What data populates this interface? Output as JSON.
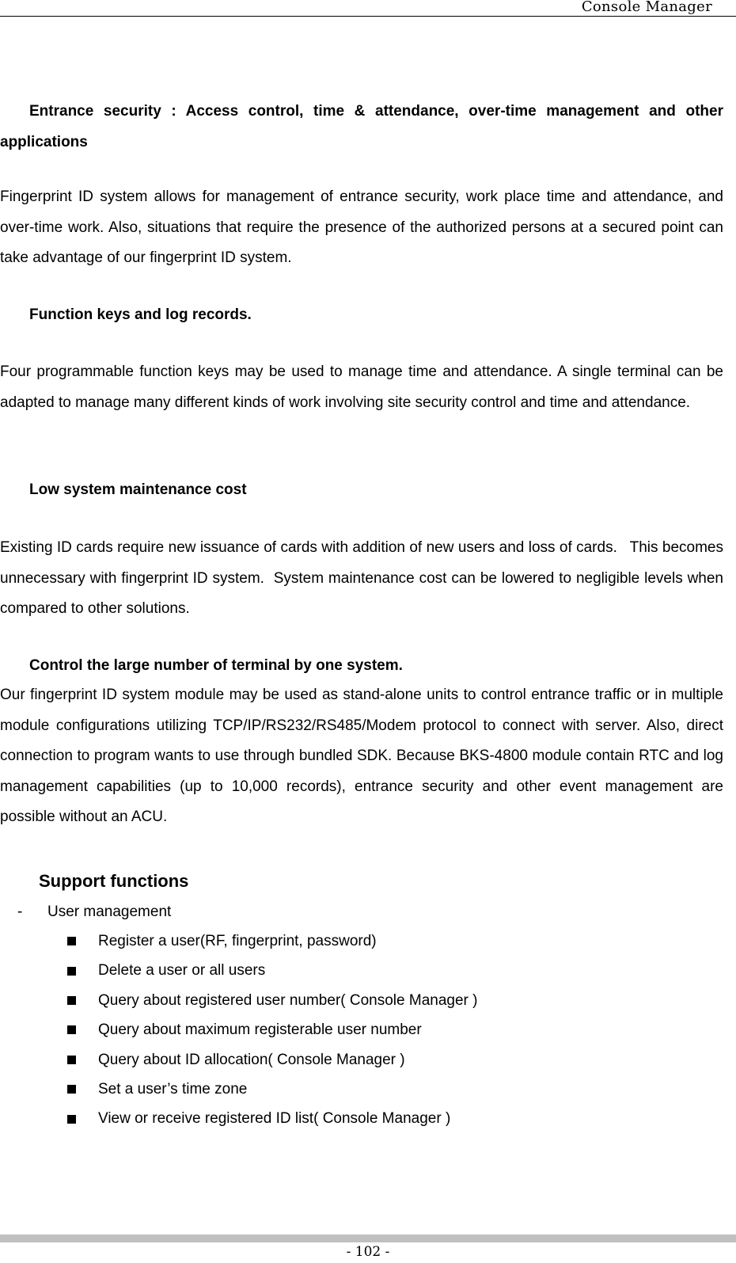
{
  "header": {
    "title": "Console Manager"
  },
  "sections": [
    {
      "heading": "Entrance security : Access control, time & attendance, over-time management and other applications",
      "body": "Fingerprint ID system allows for management of entrance security, work place time and attendance, and over-time work. Also, situations that require the presence of the authorized persons at a secured point can take advantage of our fingerprint ID system."
    },
    {
      "heading": "Function keys and log records.",
      "body": "Four programmable function keys may be used to manage time and attendance. A single terminal can be adapted to manage many different kinds of work involving site security control and time and attendance."
    },
    {
      "heading": "Low system maintenance cost",
      "body": "Existing ID cards require new issuance of cards with addition of new users and loss of cards.   This becomes unnecessary with fingerprint ID system.  System maintenance cost can be lowered to negligible levels when compared to other solutions."
    },
    {
      "heading": "Control the large number of terminal by one system.",
      "body": "Our fingerprint ID system module may be used as stand-alone units to control entrance traffic or in multiple module configurations utilizing TCP/IP/RS232/RS485/Modem protocol to connect with server. Also, direct connection to program wants to use through bundled SDK. Because BKS-4800 module contain RTC and log management capabilities (up to 10,000 records), entrance security and other event management are possible without an ACU."
    }
  ],
  "support": {
    "title": "Support functions",
    "group": {
      "marker": "-",
      "label": "User management",
      "items": [
        "Register a user(RF, fingerprint, password)",
        "Delete a user or all users",
        "Query about registered user number( Console Manager )",
        "Query about maximum registerable user number",
        "Query about ID allocation( Console Manager )",
        "Set a user’s time zone",
        "View or receive registered ID list( Console Manager )"
      ]
    }
  },
  "footer": {
    "page_number": "- 102 -"
  }
}
